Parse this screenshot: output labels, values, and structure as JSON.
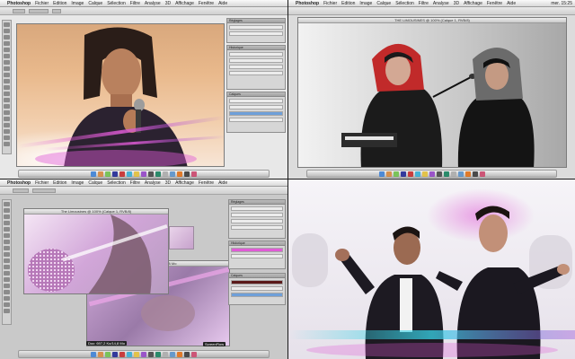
{
  "menubar": {
    "app": "Photoshop",
    "items": [
      "Fichier",
      "Edition",
      "Image",
      "Calque",
      "Sélection",
      "Filtre",
      "Analyse",
      "3D",
      "Affichage",
      "Fenêtre",
      "Aide"
    ],
    "right_text": "mer. 15:25"
  },
  "doc_title_q2": "THE LIMOUSINES @ 100% (Calque 1, RVB/8)",
  "doc_title_q3a": "The Limousines @ 100% (Calque 1, RVB/8)",
  "doc_title_q3b": "Doc: 697,2 Ko/14,8 Mo",
  "status_q3": "Doc: 697,2 Ko/14,8 Mo",
  "tooltip_q3": "ScreenFlow",
  "panels": {
    "layers": "Calques",
    "adjust": "Réglages",
    "history": "Historique"
  },
  "colors": {
    "flare_pink": "#e05bd6",
    "flare_violet": "#9b4fd8",
    "flare_cyan": "#38d4e8",
    "warm_bg": "#e9b98c",
    "selection_blue": "#6e9fd9"
  },
  "icons": [
    "apple-icon",
    "dock-app-icon",
    "tool-icon"
  ]
}
